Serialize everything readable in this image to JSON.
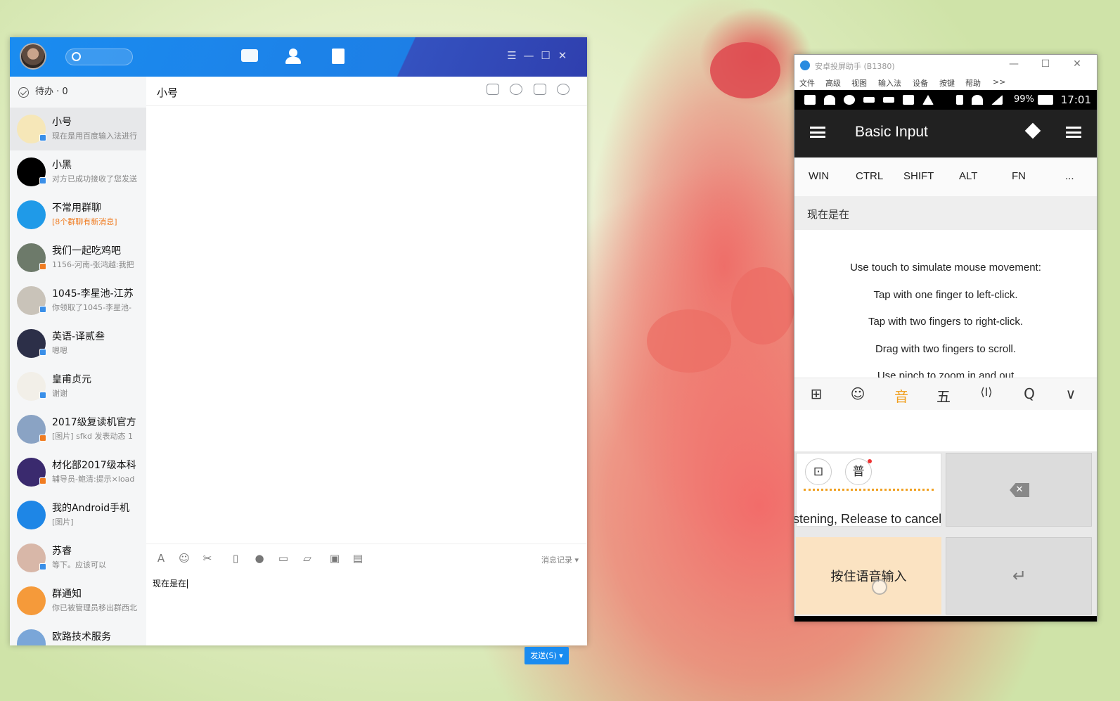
{
  "qq": {
    "search_placeholder": "",
    "todo_label": "待办 · 0",
    "chat_title": "小号",
    "history_label": "消息记录",
    "input_text": "现在是在",
    "send_label": "发送(S)",
    "contacts": [
      {
        "name": "小号",
        "preview": "现在是用百度输入法进行",
        "warn": false,
        "avatar_color": "#f6e7b8",
        "status_color": "#3a8fe8"
      },
      {
        "name": "小黑",
        "preview": "对方已成功接收了您发送",
        "warn": false,
        "avatar_color": "#000000",
        "status_color": "#3a8fe8"
      },
      {
        "name": "不常用群聊",
        "preview": "[8个群聊有新消息]",
        "warn": true,
        "avatar_color": "#1f9ae8",
        "status_color": ""
      },
      {
        "name": "我们一起吃鸡吧",
        "preview": "1156-河南-张鸿越:我把",
        "warn": false,
        "avatar_color": "#6d7a6a",
        "status_color": "#f07c21"
      },
      {
        "name": "1045-李星池-江苏",
        "preview": "你领取了1045-李星池-",
        "warn": false,
        "avatar_color": "#c9c3b9",
        "status_color": "#3a8fe8"
      },
      {
        "name": "英语-译贰叁",
        "preview": "嗯嗯",
        "warn": false,
        "avatar_color": "#2c2f48",
        "status_color": "#3a8fe8"
      },
      {
        "name": "皇甫贞元",
        "preview": "谢谢",
        "warn": false,
        "avatar_color": "#f2efe8",
        "status_color": "#3a8fe8"
      },
      {
        "name": "2017级复读机官方",
        "preview": "[图片] sfkd 发表动态 1",
        "warn": false,
        "avatar_color": "#8aa3c4",
        "status_color": "#f07c21"
      },
      {
        "name": "材化部2017级本科",
        "preview": "辅导员-鲍清:提示×load",
        "warn": false,
        "avatar_color": "#3a2a6e",
        "status_color": "#f07c21"
      },
      {
        "name": "我的Android手机",
        "preview": "[图片]",
        "warn": false,
        "avatar_color": "#1e86e6",
        "status_color": ""
      },
      {
        "name": "苏睿",
        "preview": "等下。应该可以",
        "warn": false,
        "avatar_color": "#d8b7a8",
        "status_color": "#3a8fe8"
      },
      {
        "name": "群通知",
        "preview": "你已被管理员移出群西北",
        "warn": false,
        "avatar_color": "#f59a3a",
        "status_color": ""
      },
      {
        "name": "欧路技术服务",
        "preview": "",
        "warn": false,
        "avatar_color": "#7aa6d8",
        "status_color": ""
      }
    ]
  },
  "android": {
    "window_title": "安卓投屏助手 (B1380)",
    "menu": [
      "文件",
      "高级",
      "视图",
      "输入法",
      "设备",
      "按键",
      "帮助",
      ">>"
    ],
    "battery": "99%",
    "time": "17:01",
    "app_title": "Basic Input",
    "mod_keys": [
      "WIN",
      "CTRL",
      "SHIFT",
      "ALT",
      "FN",
      "..."
    ],
    "typed_text": "现在是在",
    "instructions": [
      "Use touch to simulate mouse movement:",
      "Tap with one finger to left-click.",
      "Tap with two fingers to right-click.",
      "Drag with two fingers to scroll.",
      "Use pinch to zoom in and out"
    ],
    "ime_keys": [
      "⊞",
      "☺",
      "音",
      "五",
      "⟨I⟩",
      "Q",
      "∨"
    ],
    "voice_circle_1": "⊡",
    "voice_circle_2": "普",
    "cancel_text": "stening,  Release to cancel",
    "voice_key_label": "按住语音输入",
    "enter_symbol": "↵",
    "nav_keys": [
      "▽",
      "○",
      "□",
      "⌨"
    ]
  }
}
